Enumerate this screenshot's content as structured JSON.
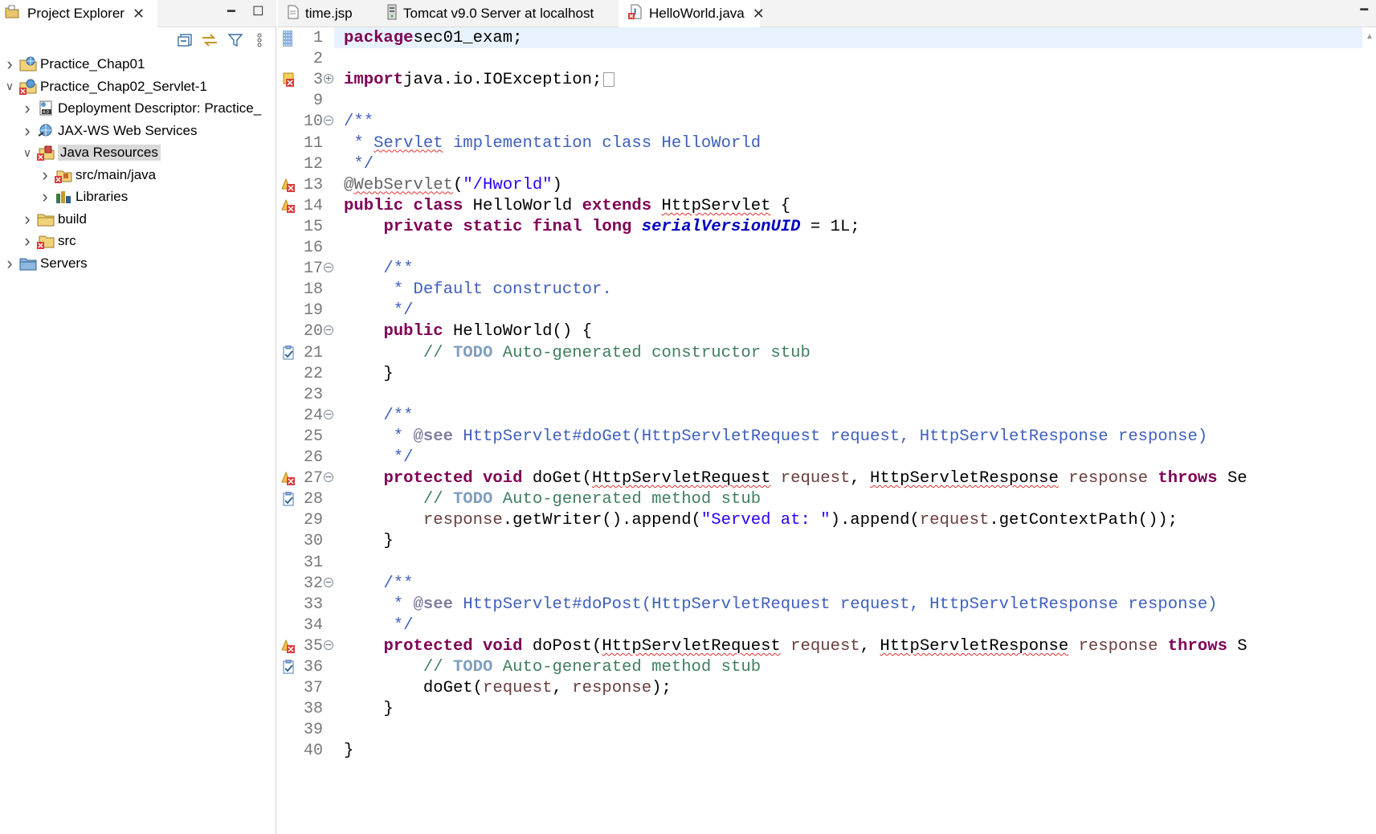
{
  "explorer": {
    "tab_label": "Project Explorer",
    "close_glyph": "✕",
    "minimize_glyph": "━",
    "maximize_glyph": "◻",
    "toolbar": [
      "collapse-all-icon",
      "link-with-editor-icon",
      "filter-icon",
      "view-menu-icon"
    ],
    "tree": [
      {
        "label": "Practice_Chap01",
        "depth": 0,
        "expanded": false,
        "icon": "web-project-icon",
        "selected": false
      },
      {
        "label": "Practice_Chap02_Servlet-1",
        "depth": 0,
        "expanded": true,
        "icon": "web-project-error-icon",
        "selected": false
      },
      {
        "label": "Deployment Descriptor: Practice_",
        "depth": 1,
        "expanded": false,
        "icon": "deployment-descriptor-icon",
        "selected": false
      },
      {
        "label": "JAX-WS Web Services",
        "depth": 1,
        "expanded": false,
        "icon": "web-services-icon",
        "selected": false
      },
      {
        "label": "Java Resources",
        "depth": 1,
        "expanded": true,
        "icon": "java-resources-error-icon",
        "selected": true
      },
      {
        "label": "src/main/java",
        "depth": 2,
        "expanded": false,
        "icon": "source-folder-error-icon",
        "selected": false
      },
      {
        "label": "Libraries",
        "depth": 2,
        "expanded": false,
        "icon": "libraries-icon",
        "selected": false
      },
      {
        "label": "build",
        "depth": 1,
        "expanded": false,
        "icon": "folder-icon",
        "selected": false
      },
      {
        "label": "src",
        "depth": 1,
        "expanded": false,
        "icon": "folder-error-icon",
        "selected": false
      },
      {
        "label": "Servers",
        "depth": 0,
        "expanded": false,
        "icon": "servers-folder-icon",
        "selected": false
      }
    ]
  },
  "editor": {
    "tabs": [
      {
        "label": "time.jsp",
        "icon": "jsp-file-icon",
        "active": false
      },
      {
        "label": "Tomcat v9.0 Server at localhost",
        "icon": "server-icon",
        "active": false
      },
      {
        "label": "HelloWorld.java",
        "icon": "java-file-error-icon",
        "active": true,
        "close": "✕"
      }
    ],
    "minimize_glyph": "━",
    "colors": {
      "keyword": "#7f0055",
      "comment": "#3f7f5f",
      "javadoc": "#3f5fbf",
      "string": "#2a00ff",
      "field": "#0000c0",
      "annotation": "#646464",
      "parameter": "#6a3e3e",
      "current_line": "#e8f2fe"
    },
    "lines": [
      {
        "num": "1",
        "marker": "bookmark",
        "fold": "",
        "tokens": [
          [
            "kw",
            "package"
          ],
          [
            "",
            "sec01_exam;"
          ]
        ]
      },
      {
        "num": "2",
        "marker": "",
        "fold": "",
        "tokens": []
      },
      {
        "num": "3",
        "marker": "error",
        "fold": "⊕",
        "tokens": [
          [
            "kw",
            "import"
          ],
          [
            "",
            "java.io.IOException;"
          ],
          [
            "box",
            ""
          ]
        ]
      },
      {
        "num": "9",
        "marker": "",
        "fold": "",
        "tokens": []
      },
      {
        "num": "10",
        "marker": "",
        "fold": "⊖",
        "tokens": [
          [
            "jd",
            "/**"
          ]
        ]
      },
      {
        "num": "11",
        "marker": "",
        "fold": "",
        "tokens": [
          [
            "jd",
            " * "
          ],
          [
            "jd squig",
            "Servlet"
          ],
          [
            "jd",
            " implementation class HelloWorld"
          ]
        ]
      },
      {
        "num": "12",
        "marker": "",
        "fold": "",
        "tokens": [
          [
            "jd",
            " */"
          ]
        ]
      },
      {
        "num": "13",
        "marker": "error-warn",
        "fold": "",
        "tokens": [
          [
            "ann",
            "@"
          ],
          [
            "ann squig",
            "WebServlet"
          ],
          [
            "",
            "("
          ],
          [
            "str",
            "\"/Hworld\""
          ],
          [
            "",
            ")"
          ]
        ]
      },
      {
        "num": "14",
        "marker": "error-warn",
        "fold": "",
        "tokens": [
          [
            "kw",
            "public"
          ],
          [
            "",
            " "
          ],
          [
            "kw",
            "class"
          ],
          [
            "",
            " HelloWorld "
          ],
          [
            "kw",
            "extends"
          ],
          [
            "",
            " "
          ],
          [
            "squig",
            "HttpServlet"
          ],
          [
            "",
            " {"
          ]
        ]
      },
      {
        "num": "15",
        "marker": "",
        "fold": "",
        "tokens": [
          [
            "",
            "    "
          ],
          [
            "kw",
            "private"
          ],
          [
            "",
            " "
          ],
          [
            "kw",
            "static"
          ],
          [
            "",
            " "
          ],
          [
            "kw",
            "final"
          ],
          [
            "",
            " "
          ],
          [
            "kw",
            "long"
          ],
          [
            "",
            " "
          ],
          [
            "fld",
            "serialVersionUID"
          ],
          [
            "",
            " = 1L;"
          ]
        ]
      },
      {
        "num": "16",
        "marker": "",
        "fold": "",
        "tokens": []
      },
      {
        "num": "17",
        "marker": "",
        "fold": "⊖",
        "tokens": [
          [
            "jd",
            "    /**"
          ]
        ]
      },
      {
        "num": "18",
        "marker": "",
        "fold": "",
        "tokens": [
          [
            "jd",
            "     * Default constructor."
          ]
        ]
      },
      {
        "num": "19",
        "marker": "",
        "fold": "",
        "tokens": [
          [
            "jd",
            "     */"
          ]
        ]
      },
      {
        "num": "20",
        "marker": "",
        "fold": "⊖",
        "tokens": [
          [
            "",
            "    "
          ],
          [
            "kw",
            "public"
          ],
          [
            "",
            " HelloWorld() {"
          ]
        ]
      },
      {
        "num": "21",
        "marker": "task",
        "fold": "",
        "tokens": [
          [
            "cm",
            "        // "
          ],
          [
            "todo",
            "TODO"
          ],
          [
            "cm",
            " Auto-generated constructor stub"
          ]
        ]
      },
      {
        "num": "22",
        "marker": "",
        "fold": "",
        "tokens": [
          [
            "",
            "    }"
          ]
        ]
      },
      {
        "num": "23",
        "marker": "",
        "fold": "",
        "tokens": []
      },
      {
        "num": "24",
        "marker": "",
        "fold": "⊖",
        "tokens": [
          [
            "jd",
            "    /**"
          ]
        ]
      },
      {
        "num": "25",
        "marker": "",
        "fold": "",
        "tokens": [
          [
            "jd",
            "     * "
          ],
          [
            "jdtag",
            "@see"
          ],
          [
            "jd",
            " HttpServlet#doGet(HttpServletRequest request, HttpServletResponse response)"
          ]
        ]
      },
      {
        "num": "26",
        "marker": "",
        "fold": "",
        "tokens": [
          [
            "jd",
            "     */"
          ]
        ]
      },
      {
        "num": "27",
        "marker": "error-warn",
        "fold": "⊖",
        "tokens": [
          [
            "",
            "    "
          ],
          [
            "kw",
            "protected"
          ],
          [
            "",
            " "
          ],
          [
            "kw",
            "void"
          ],
          [
            "",
            " doGet("
          ],
          [
            "squig",
            "HttpServletRequest"
          ],
          [
            "",
            " "
          ],
          [
            "par",
            "request"
          ],
          [
            "",
            ", "
          ],
          [
            "squig",
            "HttpServletResponse"
          ],
          [
            "",
            " "
          ],
          [
            "par",
            "response"
          ],
          [
            "",
            " "
          ],
          [
            "kw",
            "throws"
          ],
          [
            "",
            " Se"
          ]
        ]
      },
      {
        "num": "28",
        "marker": "task",
        "fold": "",
        "tokens": [
          [
            "cm",
            "        // "
          ],
          [
            "todo",
            "TODO"
          ],
          [
            "cm",
            " Auto-generated method stub"
          ]
        ]
      },
      {
        "num": "29",
        "marker": "",
        "fold": "",
        "tokens": [
          [
            "",
            "        "
          ],
          [
            "par",
            "response"
          ],
          [
            "",
            ".getWriter().append("
          ],
          [
            "str",
            "\"Served at: \""
          ],
          [
            "",
            ").append("
          ],
          [
            "par",
            "request"
          ],
          [
            "",
            ".getContextPath());"
          ]
        ]
      },
      {
        "num": "30",
        "marker": "",
        "fold": "",
        "tokens": [
          [
            "",
            "    }"
          ]
        ]
      },
      {
        "num": "31",
        "marker": "",
        "fold": "",
        "tokens": []
      },
      {
        "num": "32",
        "marker": "",
        "fold": "⊖",
        "tokens": [
          [
            "jd",
            "    /**"
          ]
        ]
      },
      {
        "num": "33",
        "marker": "",
        "fold": "",
        "tokens": [
          [
            "jd",
            "     * "
          ],
          [
            "jdtag",
            "@see"
          ],
          [
            "jd",
            " HttpServlet#doPost(HttpServletRequest request, HttpServletResponse response)"
          ]
        ]
      },
      {
        "num": "34",
        "marker": "",
        "fold": "",
        "tokens": [
          [
            "jd",
            "     */"
          ]
        ]
      },
      {
        "num": "35",
        "marker": "error-warn",
        "fold": "⊖",
        "tokens": [
          [
            "",
            "    "
          ],
          [
            "kw",
            "protected"
          ],
          [
            "",
            " "
          ],
          [
            "kw",
            "void"
          ],
          [
            "",
            " doPost("
          ],
          [
            "squig",
            "HttpServletRequest"
          ],
          [
            "",
            " "
          ],
          [
            "par",
            "request"
          ],
          [
            "",
            ", "
          ],
          [
            "squig",
            "HttpServletResponse"
          ],
          [
            "",
            " "
          ],
          [
            "par",
            "response"
          ],
          [
            "",
            " "
          ],
          [
            "kw",
            "throws"
          ],
          [
            "",
            " S"
          ]
        ]
      },
      {
        "num": "36",
        "marker": "task",
        "fold": "",
        "tokens": [
          [
            "cm",
            "        // "
          ],
          [
            "todo",
            "TODO"
          ],
          [
            "cm",
            " Auto-generated method stub"
          ]
        ]
      },
      {
        "num": "37",
        "marker": "",
        "fold": "",
        "tokens": [
          [
            "",
            "        doGet("
          ],
          [
            "par",
            "request"
          ],
          [
            "",
            ", "
          ],
          [
            "par",
            "response"
          ],
          [
            "",
            ");"
          ]
        ]
      },
      {
        "num": "38",
        "marker": "",
        "fold": "",
        "tokens": [
          [
            "",
            "    }"
          ]
        ]
      },
      {
        "num": "39",
        "marker": "",
        "fold": "",
        "tokens": []
      },
      {
        "num": "40",
        "marker": "",
        "fold": "",
        "tokens": [
          [
            "",
            "}"
          ]
        ]
      }
    ]
  }
}
